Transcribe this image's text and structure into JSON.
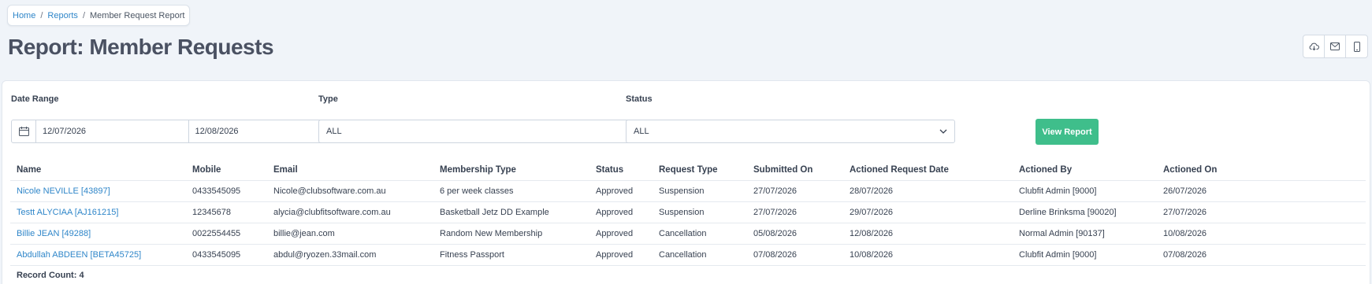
{
  "breadcrumb": {
    "home": "Home",
    "reports": "Reports",
    "current": "Member Request Report"
  },
  "page_title": "Report: Member Requests",
  "toolbar": {
    "icons": [
      "cloud-download-icon",
      "email-icon",
      "mobile-icon"
    ]
  },
  "filters": {
    "date_range_label": "Date Range",
    "date_from": "12/07/2026",
    "date_to": "12/08/2026",
    "type_label": "Type",
    "type_value": "ALL",
    "status_label": "Status",
    "status_value": "ALL",
    "view_button": "View Report"
  },
  "table": {
    "headers": [
      "Name",
      "Mobile",
      "Email",
      "Membership Type",
      "Status",
      "Request Type",
      "Submitted On",
      "Actioned Request Date",
      "Actioned By",
      "Actioned On"
    ],
    "rows": [
      [
        "Nicole NEVILLE [43897]",
        "0433545095",
        "Nicole@clubsoftware.com.au",
        "6 per week classes",
        "Approved",
        "Suspension",
        "27/07/2026",
        "28/07/2026",
        "Clubfit Admin [9000]",
        "26/07/2026"
      ],
      [
        "Testt ALYCIAA [AJ161215]",
        "12345678",
        "alycia@clubfitsoftware.com.au",
        "Basketball Jetz DD Example",
        "Approved",
        "Suspension",
        "27/07/2026",
        "29/07/2026",
        "Derline Brinksma [90020]",
        "27/07/2026"
      ],
      [
        "Billie JEAN [49288]",
        "0022554455",
        "billie@jean.com",
        "Random New Membership",
        "Approved",
        "Cancellation",
        "05/08/2026",
        "12/08/2026",
        "Normal Admin [90137]",
        "10/08/2026"
      ],
      [
        "Abdullah ABDEEN [BETA45725]",
        "0433545095",
        "abdul@ryozen.33mail.com",
        "Fitness Passport",
        "Approved",
        "Cancellation",
        "07/08/2026",
        "10/08/2026",
        "Clubfit Admin [9000]",
        "07/08/2026"
      ]
    ]
  },
  "record_count": "Record Count: 4",
  "colors": {
    "accent_link": "#2f86c9",
    "view_button": "#3fbe8b",
    "background": "#f0f4f9"
  }
}
